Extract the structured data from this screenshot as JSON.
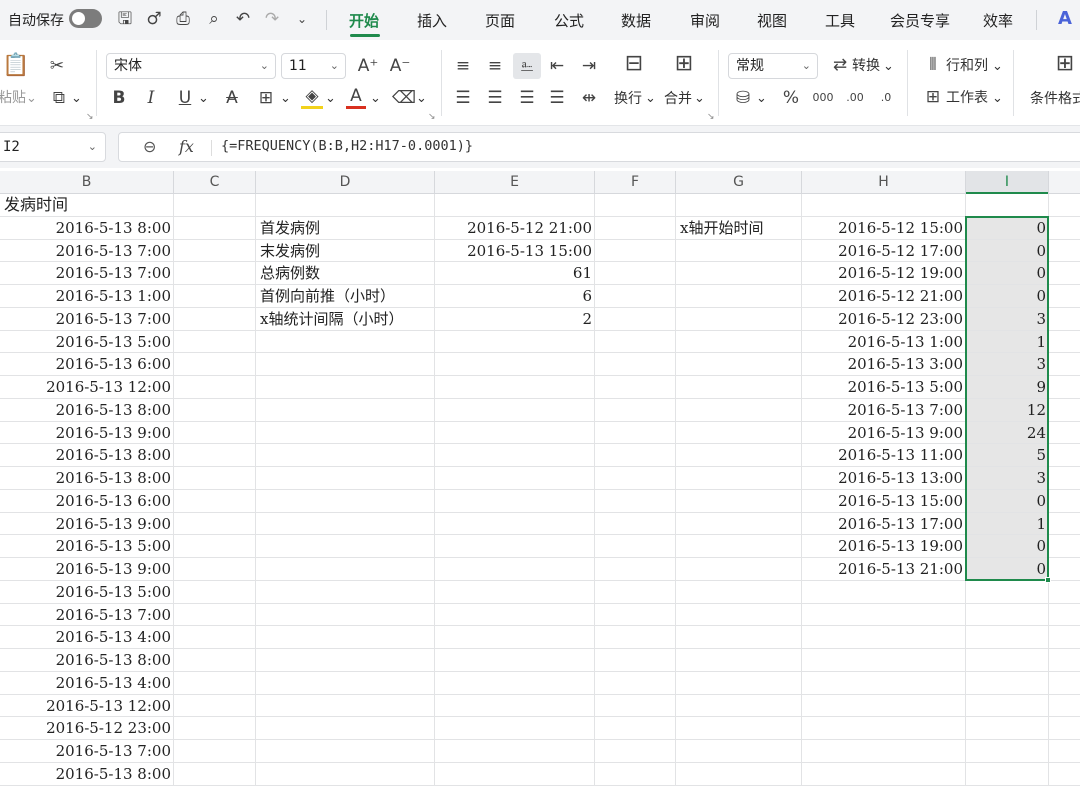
{
  "topbar": {
    "autosave_label": "自动保存",
    "tabs": [
      "开始",
      "插入",
      "页面",
      "公式",
      "数据",
      "审阅",
      "视图",
      "工具",
      "会员专享",
      "效率"
    ],
    "active_tab": "开始"
  },
  "ribbon": {
    "paste_label": "粘贴",
    "font_name": "宋体",
    "font_size": "11",
    "number_format": "常规",
    "convert_label": "转换",
    "rows_cols_label": "行和列",
    "worksheet_label": "工作表",
    "wrap_label": "换行",
    "merge_label": "合并",
    "cond_format_label": "条件格式",
    "accent_color": "#1f8a4c"
  },
  "formula_bar": {
    "cell_ref": "I2",
    "formula": "{=FREQUENCY(B:B,H2:H17-0.0001)}"
  },
  "grid": {
    "columns": [
      "B",
      "C",
      "D",
      "E",
      "F",
      "G",
      "H",
      "I"
    ],
    "selected_column": "I",
    "b_header": "发病时间",
    "b_values": [
      "2016-5-13 8:00",
      "2016-5-13 7:00",
      "2016-5-13 7:00",
      "2016-5-13 1:00",
      "2016-5-13 7:00",
      "2016-5-13 5:00",
      "2016-5-13 6:00",
      "2016-5-13 12:00",
      "2016-5-13 8:00",
      "2016-5-13 9:00",
      "2016-5-13 8:00",
      "2016-5-13 8:00",
      "2016-5-13 6:00",
      "2016-5-13 9:00",
      "2016-5-13 5:00",
      "2016-5-13 9:00",
      "2016-5-13 5:00",
      "2016-5-13 7:00",
      "2016-5-13 4:00",
      "2016-5-13 8:00",
      "2016-5-13 4:00",
      "2016-5-13 12:00",
      "2016-5-12 23:00",
      "2016-5-13 7:00",
      "2016-5-13 8:00"
    ],
    "d_labels": [
      "首发病例",
      "末发病例",
      "总病例数",
      "首例向前推（小时）",
      "x轴统计间隔（小时）"
    ],
    "e_values": [
      "2016-5-12 21:00",
      "2016-5-13 15:00",
      "61",
      "6",
      "2"
    ],
    "g_label": "x轴开始时间",
    "h_values": [
      "2016-5-12 15:00",
      "2016-5-12 17:00",
      "2016-5-12 19:00",
      "2016-5-12 21:00",
      "2016-5-12 23:00",
      "2016-5-13 1:00",
      "2016-5-13 3:00",
      "2016-5-13 5:00",
      "2016-5-13 7:00",
      "2016-5-13 9:00",
      "2016-5-13 11:00",
      "2016-5-13 13:00",
      "2016-5-13 15:00",
      "2016-5-13 17:00",
      "2016-5-13 19:00",
      "2016-5-13 21:00"
    ],
    "i_values": [
      "0",
      "0",
      "0",
      "0",
      "3",
      "1",
      "3",
      "9",
      "12",
      "24",
      "5",
      "3",
      "0",
      "1",
      "0",
      "0"
    ]
  }
}
